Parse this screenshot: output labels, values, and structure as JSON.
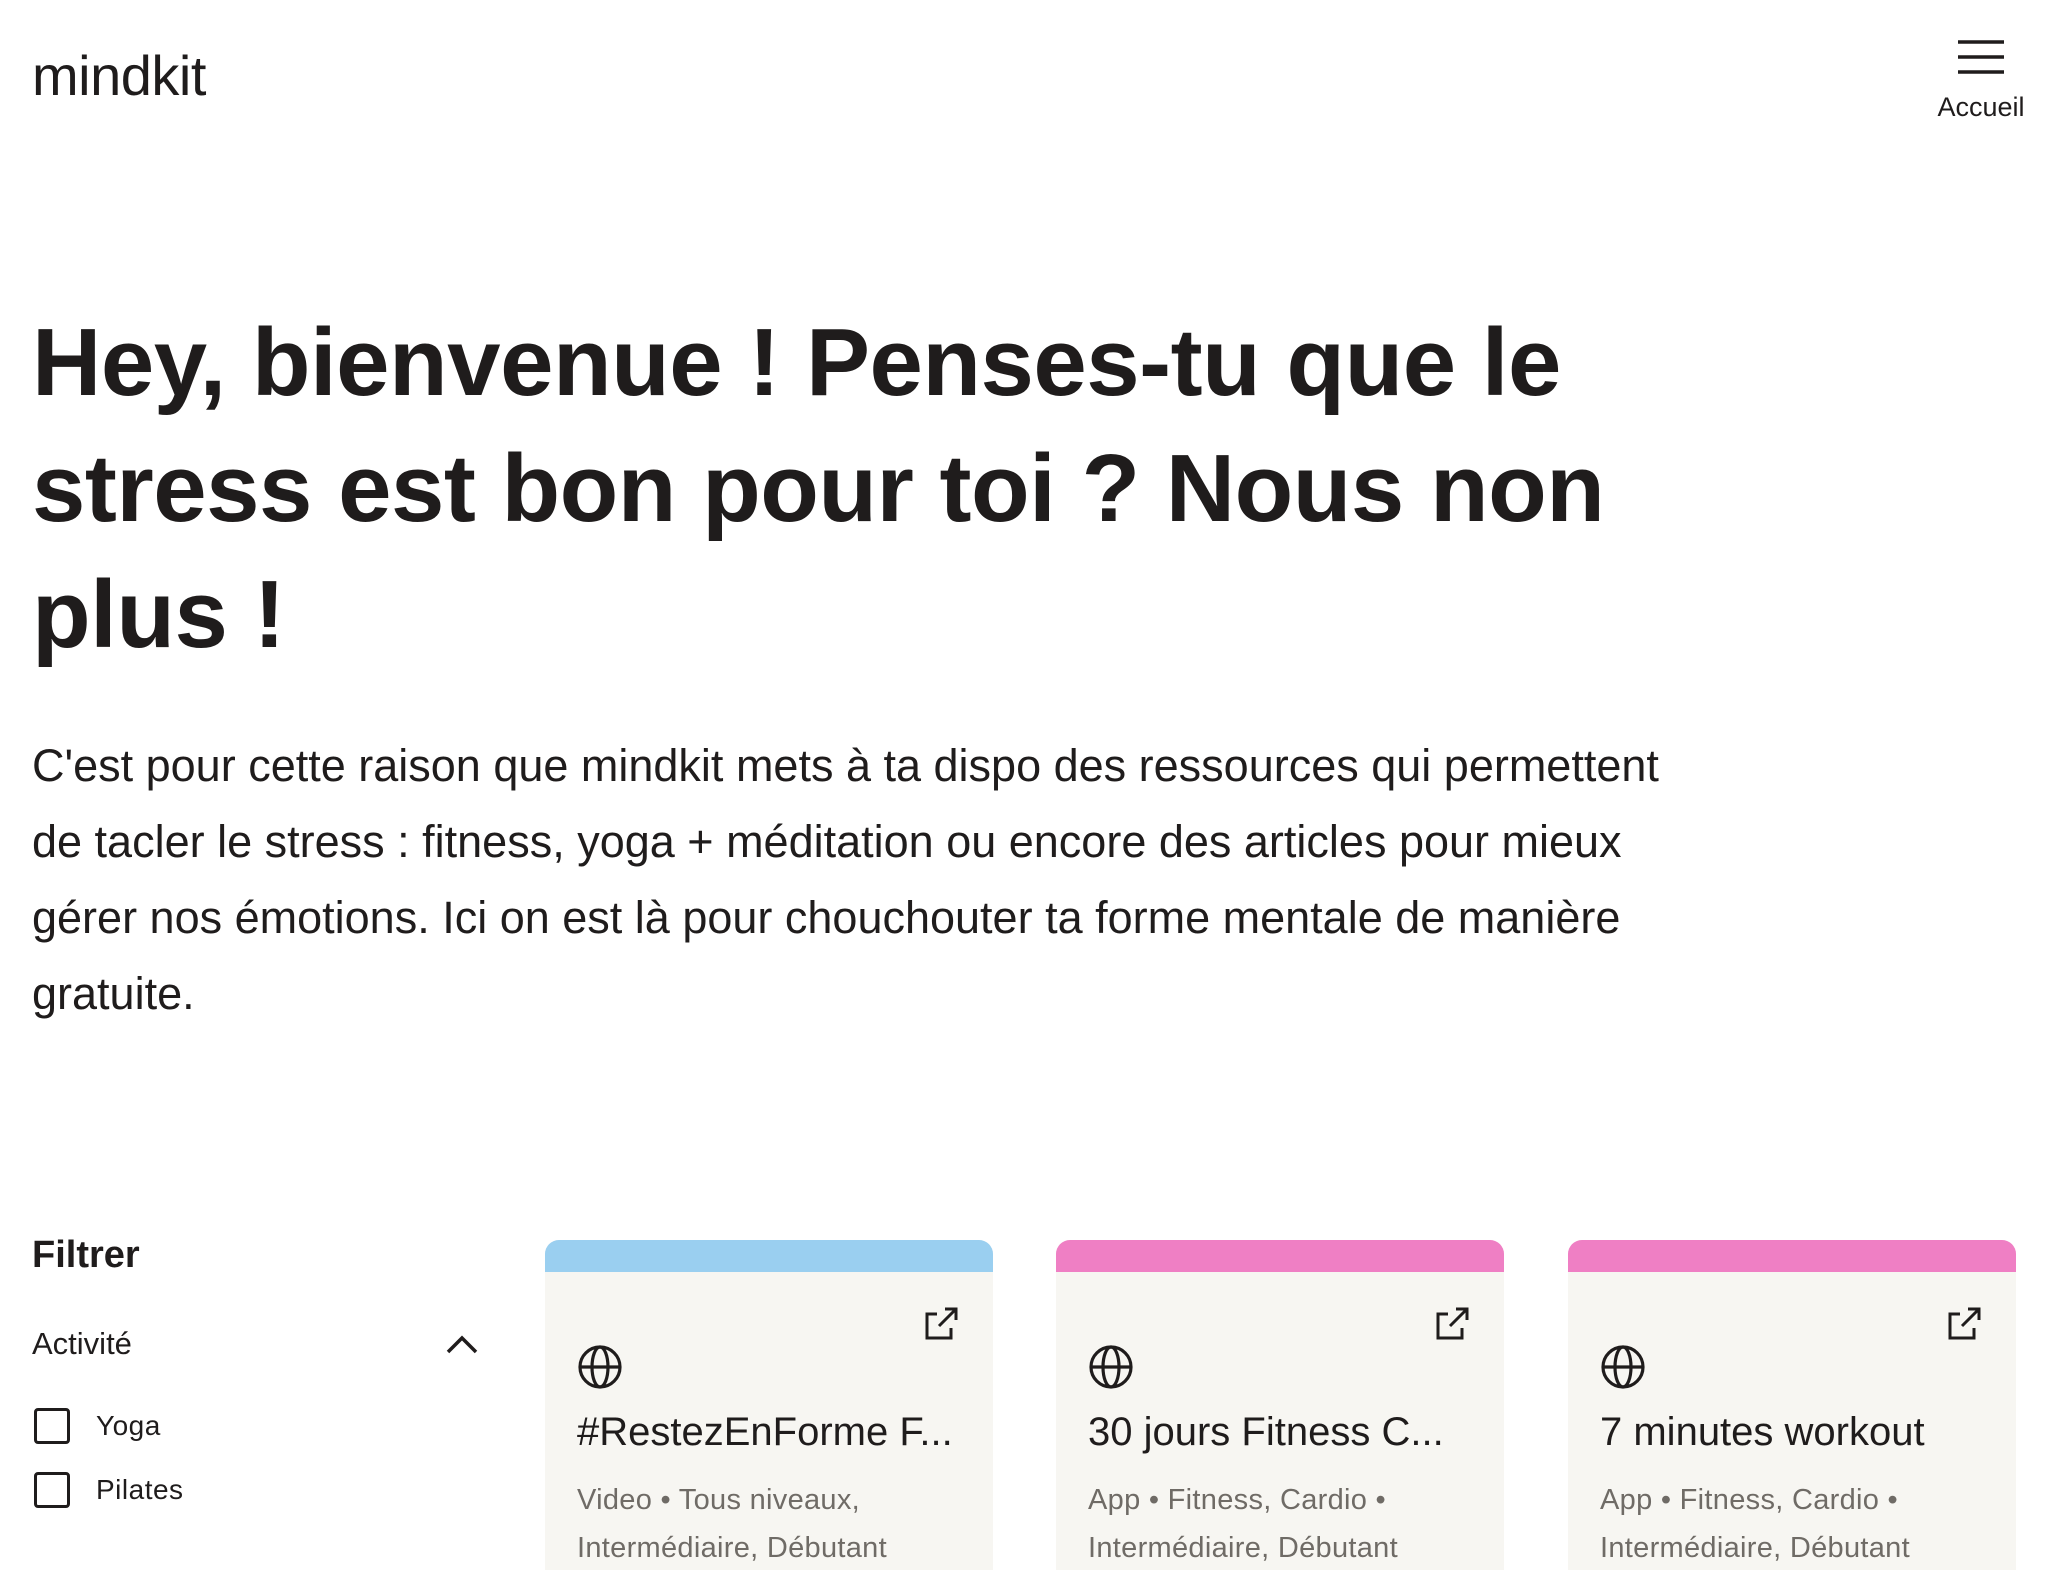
{
  "header": {
    "logo": "mindkit",
    "menu_label": "Accueil"
  },
  "hero": {
    "title": "Hey, bienvenue ! Penses-tu que le stress est bon pour toi ? Nous non plus !",
    "text": "C'est pour cette raison que mindkit mets à ta dispo des ressources qui permettent de tacler le stress : fitness, yoga + méditation ou encore des articles pour mieux gérer nos émotions. Ici on est là pour chouchouter ta forme mentale de manière gratuite."
  },
  "filters": {
    "title": "Filtrer",
    "group": {
      "label": "Activité",
      "expanded": true,
      "options": [
        {
          "label": "Yoga",
          "checked": false
        },
        {
          "label": "Pilates",
          "checked": false
        }
      ]
    }
  },
  "cards": [
    {
      "title": "#RestezEnForme F...",
      "meta_line1": "Video • Tous niveaux,",
      "meta_line2": "Intermédiaire, Débutant",
      "accent": "#9acff0",
      "icon": "globe-icon",
      "action_icon": "external-link-icon"
    },
    {
      "title": "30 jours Fitness C...",
      "meta_line1": "App • Fitness, Cardio •",
      "meta_line2": "Intermédiaire, Débutant",
      "accent": "#ef7fc4",
      "icon": "globe-icon",
      "action_icon": "external-link-icon"
    },
    {
      "title": "7 minutes workout",
      "meta_line1": "App • Fitness, Cardio •",
      "meta_line2": "Intermédiaire, Débutant",
      "accent": "#ef7fc4",
      "icon": "globe-icon",
      "action_icon": "external-link-icon"
    }
  ]
}
